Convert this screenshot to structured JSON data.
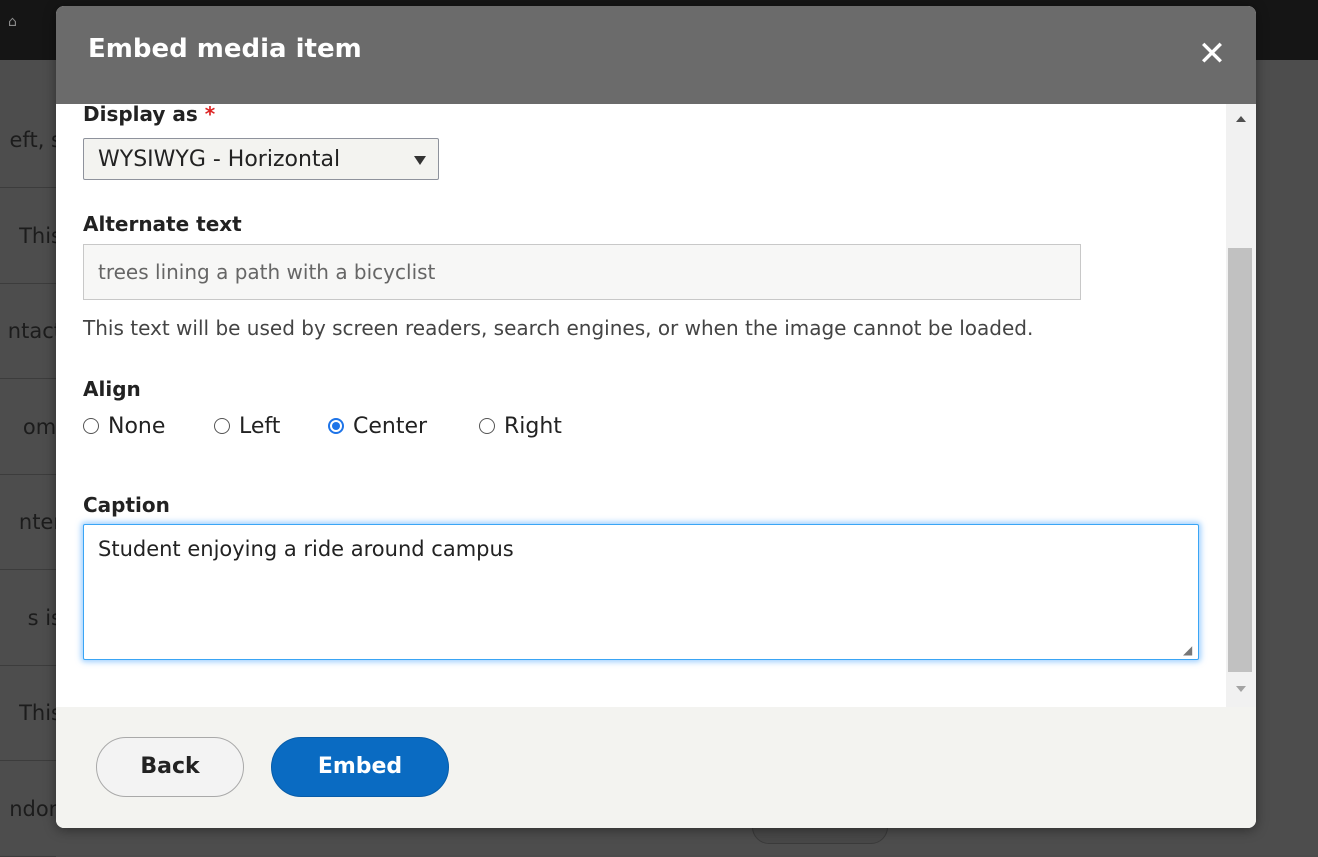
{
  "background": {
    "rows": [
      "eft, s",
      "This",
      "ntact",
      "omi",
      "nter",
      "s is",
      "This",
      "ndon"
    ]
  },
  "dialog": {
    "title": "Embed media item",
    "close_icon": "close-icon"
  },
  "form": {
    "display_as": {
      "label": "Display as",
      "required_mark": "*",
      "selected": "WYSIWYG - Horizontal"
    },
    "alt_text": {
      "label": "Alternate text",
      "value": "trees lining a path with a bicyclist",
      "help": "This text will be used by screen readers, search engines, or when the image cannot be loaded."
    },
    "align": {
      "label": "Align",
      "options": [
        "None",
        "Left",
        "Center",
        "Right"
      ],
      "selected": "Center"
    },
    "caption": {
      "label": "Caption",
      "value": "Student enjoying a ride around campus"
    }
  },
  "footer": {
    "back_label": "Back",
    "embed_label": "Embed"
  },
  "colors": {
    "primary": "#0a6bc2",
    "header": "#6b6b6b",
    "required": "#dc2323",
    "focus": "#3aa5f5"
  }
}
